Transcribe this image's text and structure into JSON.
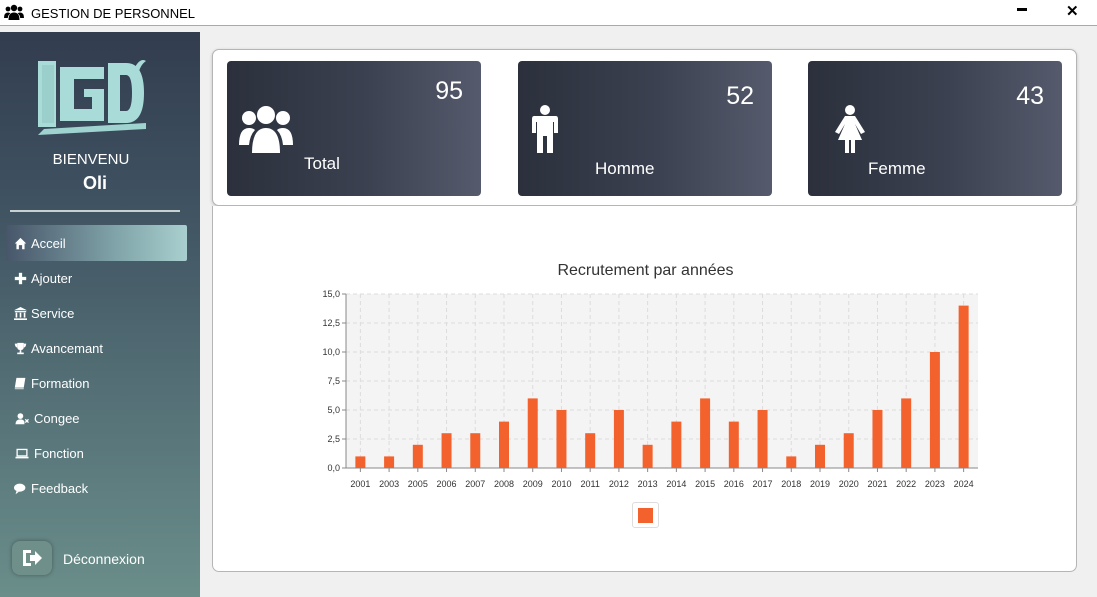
{
  "window": {
    "title": "GESTION DE PERSONNEL",
    "icon": "users-icon"
  },
  "sidebar": {
    "welcome": "BIENVENU",
    "username": "Oli",
    "items": [
      {
        "label": "Acceil",
        "icon": "home-icon",
        "active": true
      },
      {
        "label": "Ajouter",
        "icon": "plus-icon"
      },
      {
        "label": "Service",
        "icon": "bank-icon"
      },
      {
        "label": "Avancemant",
        "icon": "trophy-icon"
      },
      {
        "label": "Formation",
        "icon": "book-icon"
      },
      {
        "label": "Congee",
        "icon": "user-times-icon"
      },
      {
        "label": "Fonction",
        "icon": "laptop-icon"
      },
      {
        "label": "Feedback",
        "icon": "comments-icon"
      }
    ],
    "logout_label": "Déconnexion"
  },
  "stats": {
    "total": {
      "value": "95",
      "label": "Total"
    },
    "homme": {
      "value": "52",
      "label": "Homme"
    },
    "femme": {
      "value": "43",
      "label": "Femme"
    }
  },
  "colors": {
    "bar": "#f3622d",
    "card_dark": "#2b303c",
    "sidebar_top": "#323d4f",
    "sidebar_bottom": "#6a8e8a"
  },
  "chart_data": {
    "type": "bar",
    "title": "Recrutement par années",
    "categories": [
      "2001",
      "2003",
      "2005",
      "2006",
      "2007",
      "2008",
      "2009",
      "2010",
      "2011",
      "2012",
      "2013",
      "2014",
      "2015",
      "2016",
      "2017",
      "2018",
      "2019",
      "2020",
      "2021",
      "2022",
      "2023",
      "2024"
    ],
    "series": [
      {
        "values": [
          1,
          1,
          2,
          3,
          3,
          4,
          6,
          5,
          3,
          5,
          2,
          4,
          6,
          4,
          5,
          1,
          2,
          3,
          5,
          6,
          10,
          14
        ]
      }
    ],
    "ylim": [
      0,
      15
    ],
    "yticks": [
      "0,0",
      "2,5",
      "5,0",
      "7,5",
      "10,0",
      "12,5",
      "15,0"
    ],
    "grid": true,
    "legend": "bottom"
  }
}
